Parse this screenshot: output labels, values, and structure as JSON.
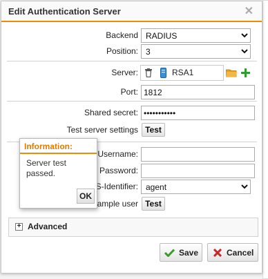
{
  "dialog": {
    "title": "Edit Authentication Server",
    "close_symbol": "✕"
  },
  "form": {
    "backend_label": "Backend",
    "backend_value": "RADIUS",
    "position_label": "Position:",
    "position_value": "3",
    "server_label": "Server:",
    "server_value": "RSA1",
    "port_label": "Port:",
    "port_value": "1812",
    "secret_label": "Shared secret:",
    "secret_value": "•••••••••••",
    "test_server_label": "Test server settings",
    "test_button": "Test",
    "username_label": "Username:",
    "username_value": "",
    "password_label": "Password:",
    "password_value": "",
    "nas_label": "NAS-Identifier:",
    "nas_value": "agent",
    "auth_example_label": "Authenticate example user",
    "auth_test_button": "Test"
  },
  "advanced": {
    "toggle": "+",
    "label": "Advanced"
  },
  "footer": {
    "save_label": "Save",
    "cancel_label": "Cancel"
  },
  "popup": {
    "title": "Information:",
    "message": "Server test passed.",
    "ok_label": "OK"
  },
  "colors": {
    "accent": "#f08a00",
    "save_green": "#3a9a2a",
    "cancel_red": "#c62828",
    "add_green": "#2e9e2e",
    "folder_orange": "#e8a020",
    "server_blue": "#3a8fd6"
  },
  "icons": [
    "trash-icon",
    "server-icon",
    "folder-icon",
    "add-icon",
    "check-icon",
    "x-icon",
    "expand-icon"
  ]
}
